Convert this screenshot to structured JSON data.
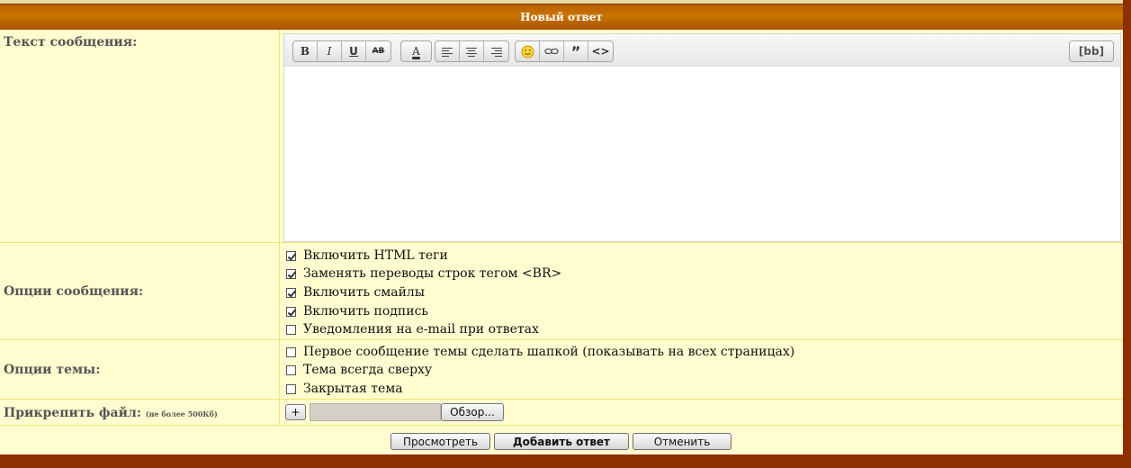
{
  "header": {
    "title": "Новый ответ"
  },
  "message": {
    "label": "Текст сообщения:"
  },
  "toolbar": {
    "bold": "B",
    "italic": "I",
    "underline": "U",
    "strike": "AB",
    "color": "A",
    "quote": "”",
    "code": "<>",
    "bb": "[bb]"
  },
  "message_options": {
    "label": "Опции сообщения:",
    "items": [
      {
        "label": "Включить HTML теги",
        "checked": true
      },
      {
        "label": "Заменять переводы строк тегом <BR>",
        "checked": true
      },
      {
        "label": "Включить смайлы",
        "checked": true
      },
      {
        "label": "Включить подпись",
        "checked": true
      },
      {
        "label": "Уведомления на e-mail при ответах",
        "checked": false
      }
    ]
  },
  "topic_options": {
    "label": "Опции темы:",
    "items": [
      {
        "label": "Первое сообщение темы сделать шапкой (показывать на всех страницах)",
        "checked": false
      },
      {
        "label": "Тема всегда сверху",
        "checked": false
      },
      {
        "label": "Закрытая тема",
        "checked": false
      }
    ]
  },
  "attach": {
    "label": "Прикрепить файл:",
    "note": "(не более 500Кб)",
    "add_label": "+",
    "browse_label": "Обзор..."
  },
  "actions": {
    "preview": "Просмотреть",
    "submit": "Добавить ответ",
    "cancel": "Отменить"
  }
}
